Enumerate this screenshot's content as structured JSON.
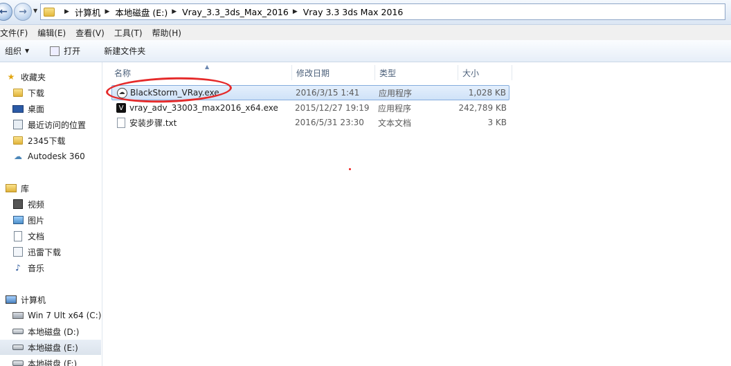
{
  "address": {
    "crumbs": [
      "计算机",
      "本地磁盘 (E:)",
      "Vray_3.3_3ds_Max_2016",
      "Vray 3.3 3ds Max 2016"
    ]
  },
  "menu": [
    "文件(F)",
    "编辑(E)",
    "查看(V)",
    "工具(T)",
    "帮助(H)"
  ],
  "toolbar": {
    "organize": "组织",
    "open": "打开",
    "new_folder": "新建文件夹"
  },
  "nav": {
    "favorites": "收藏夹",
    "downloads": "下载",
    "desktop": "桌面",
    "recent": "最近访问的位置",
    "d2345": "2345下载",
    "autodesk": "Autodesk 360",
    "libraries": "库",
    "videos": "视频",
    "pictures": "图片",
    "documents": "文档",
    "thunder": "迅雷下载",
    "music": "音乐",
    "computer": "计算机",
    "drive_c": "Win 7 Ult x64 (C:)",
    "drive_d": "本地磁盘 (D:)",
    "drive_e": "本地磁盘 (E:)",
    "drive_f": "本地磁盘 (F:)"
  },
  "columns": {
    "name": "名称",
    "modified": "修改日期",
    "type": "类型",
    "size": "大小"
  },
  "files": [
    {
      "name": "BlackStorm_VRay.exe",
      "modified": "2016/3/15 1:41",
      "type": "应用程序",
      "size": "1,028 KB"
    },
    {
      "name": "vray_adv_33003_max2016_x64.exe",
      "modified": "2015/12/27 19:19",
      "type": "应用程序",
      "size": "242,789 KB"
    },
    {
      "name": "安装步骤.txt",
      "modified": "2016/5/31 23:30",
      "type": "文本文档",
      "size": "3 KB"
    }
  ]
}
